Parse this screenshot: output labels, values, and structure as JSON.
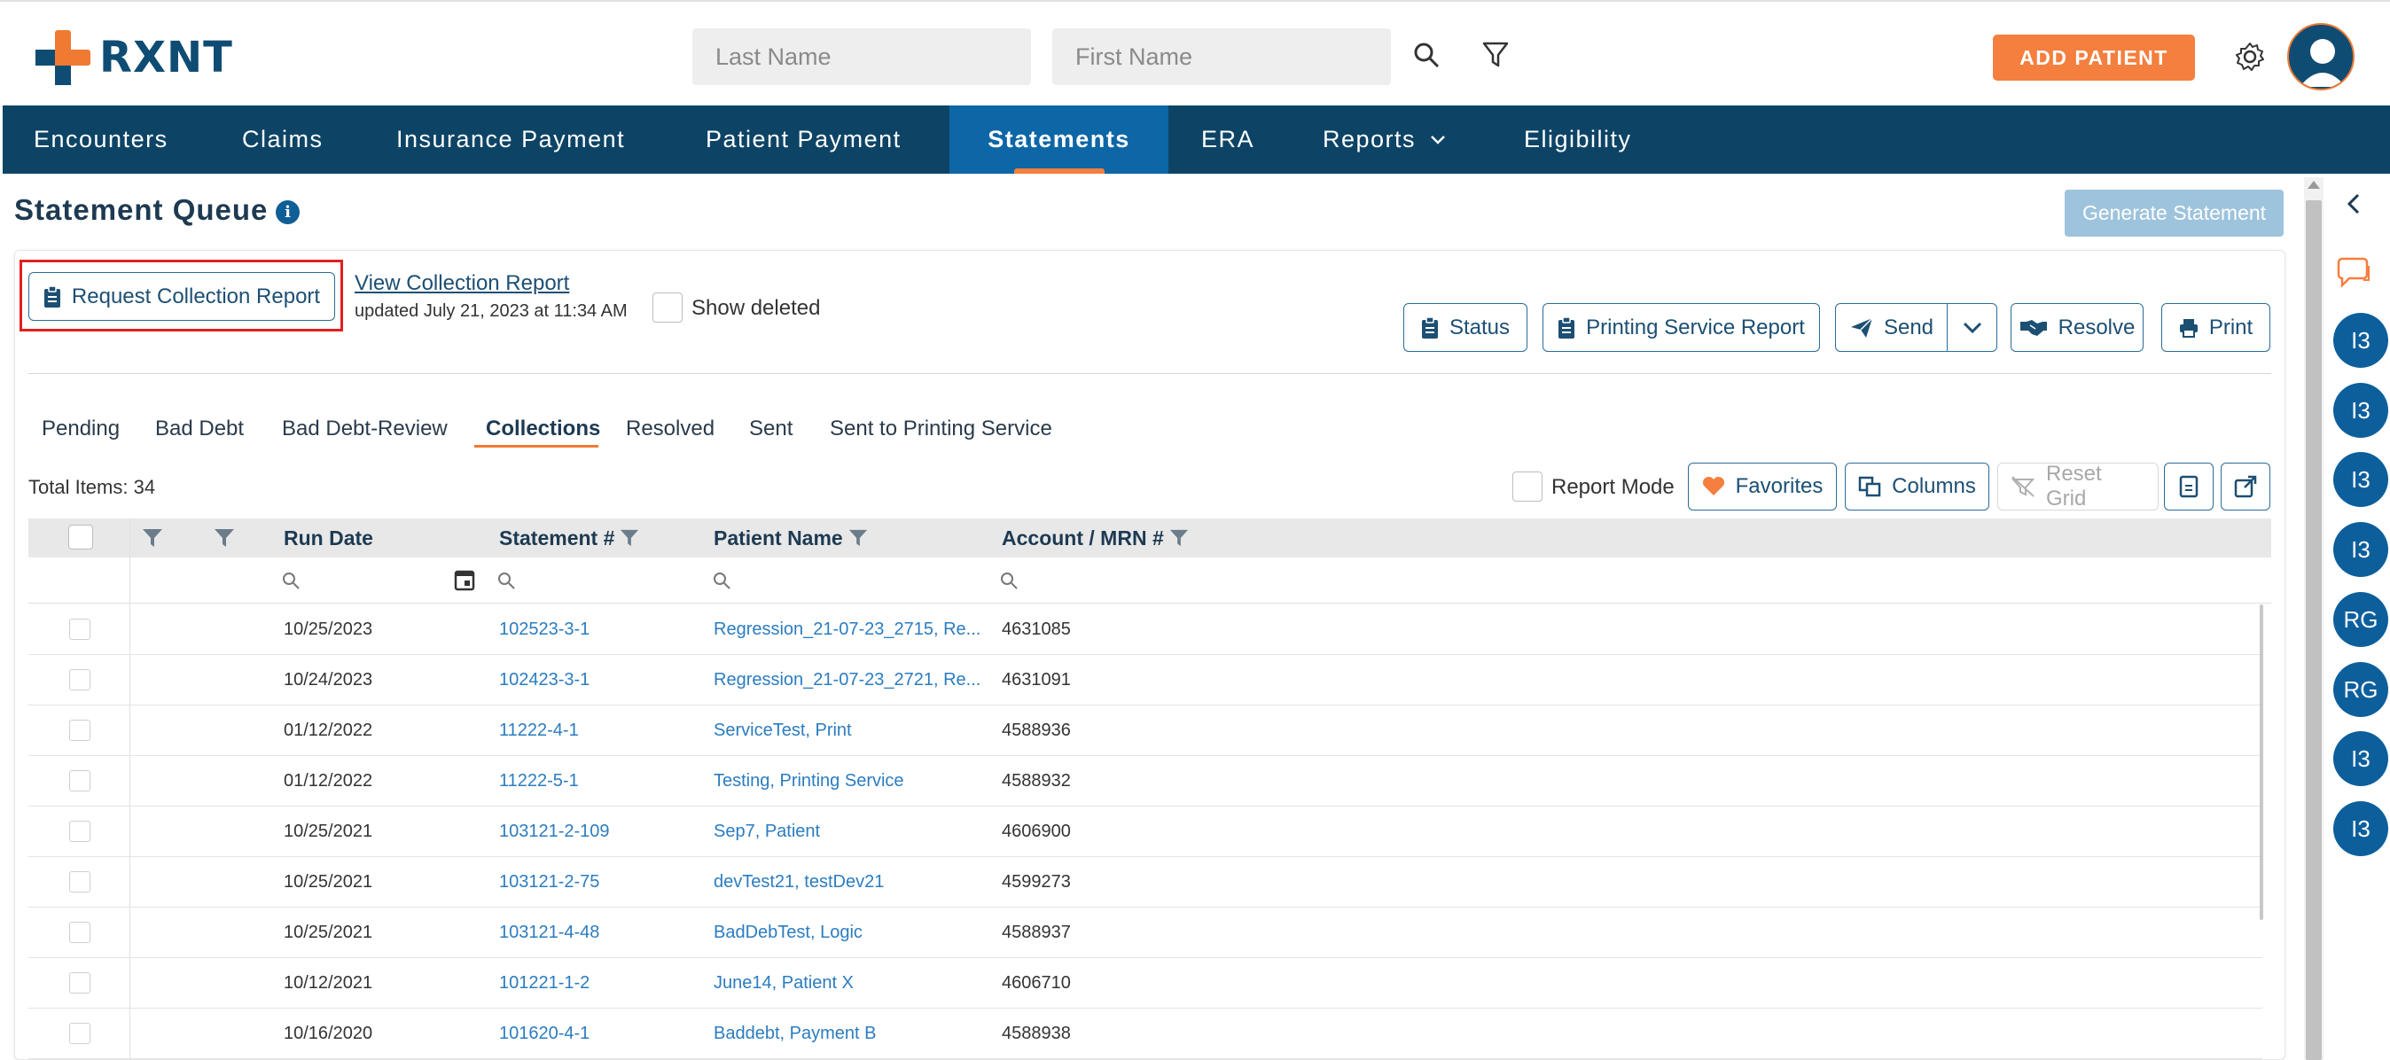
{
  "header": {
    "logo_text": "RXNT",
    "last_name_placeholder": "Last Name",
    "first_name_placeholder": "First Name",
    "add_patient_label": "ADD PATIENT"
  },
  "nav": {
    "items": [
      {
        "label": "Encounters"
      },
      {
        "label": "Claims"
      },
      {
        "label": "Insurance Payment"
      },
      {
        "label": "Patient Payment"
      },
      {
        "label": "Statements"
      },
      {
        "label": "ERA"
      },
      {
        "label": "Reports"
      },
      {
        "label": "Eligibility"
      }
    ],
    "active": "Statements"
  },
  "page": {
    "title": "Statement Queue",
    "generate_label": "Generate Statement"
  },
  "toolbar": {
    "request_report_label": "Request Collection Report",
    "view_report_link": "View Collection Report",
    "updated_text": "updated July 21, 2023 at 11:34 AM",
    "show_deleted_label": "Show deleted",
    "status_label": "Status",
    "printing_report_label": "Printing Service Report",
    "send_label": "Send",
    "resolve_label": "Resolve",
    "print_label": "Print"
  },
  "tabs": [
    {
      "label": "Pending"
    },
    {
      "label": "Bad Debt"
    },
    {
      "label": "Bad Debt-Review"
    },
    {
      "label": "Collections"
    },
    {
      "label": "Resolved"
    },
    {
      "label": "Sent"
    },
    {
      "label": "Sent to Printing Service"
    }
  ],
  "active_tab": "Collections",
  "grid_tools": {
    "total_items": "Total Items: 34",
    "report_mode_label": "Report Mode",
    "favorites_label": "Favorites",
    "columns_label": "Columns",
    "reset_grid_label": "Reset Grid"
  },
  "grid": {
    "columns": [
      "Run Date",
      "Statement #",
      "Patient Name",
      "Account / MRN #"
    ],
    "rows": [
      {
        "run_date": "10/25/2023",
        "statement": "102523-3-1",
        "patient": "Regression_21-07-23_2715, Re...",
        "account": "4631085"
      },
      {
        "run_date": "10/24/2023",
        "statement": "102423-3-1",
        "patient": "Regression_21-07-23_2721, Re...",
        "account": "4631091"
      },
      {
        "run_date": "01/12/2022",
        "statement": "11222-4-1",
        "patient": "ServiceTest, Print",
        "account": "4588936"
      },
      {
        "run_date": "01/12/2022",
        "statement": "11222-5-1",
        "patient": "Testing, Printing Service",
        "account": "4588932"
      },
      {
        "run_date": "10/25/2021",
        "statement": "103121-2-109",
        "patient": "Sep7, Patient",
        "account": "4606900"
      },
      {
        "run_date": "10/25/2021",
        "statement": "103121-2-75",
        "patient": "devTest21, testDev21",
        "account": "4599273"
      },
      {
        "run_date": "10/25/2021",
        "statement": "103121-4-48",
        "patient": "BadDebTest, Logic",
        "account": "4588937"
      },
      {
        "run_date": "10/12/2021",
        "statement": "101221-1-2",
        "patient": "June14, Patient X",
        "account": "4606710"
      },
      {
        "run_date": "10/16/2020",
        "statement": "101620-4-1",
        "patient": "Baddebt, Payment B",
        "account": "4588938"
      }
    ]
  },
  "right_rail": {
    "avatars": [
      "I3",
      "I3",
      "I3",
      "I3",
      "RG",
      "RG",
      "I3",
      "I3"
    ]
  },
  "colors": {
    "navy": "#0d4466",
    "active_tab": "#0d66a6",
    "accent_orange": "#f47f3e",
    "link_blue": "#2b7cc0"
  }
}
